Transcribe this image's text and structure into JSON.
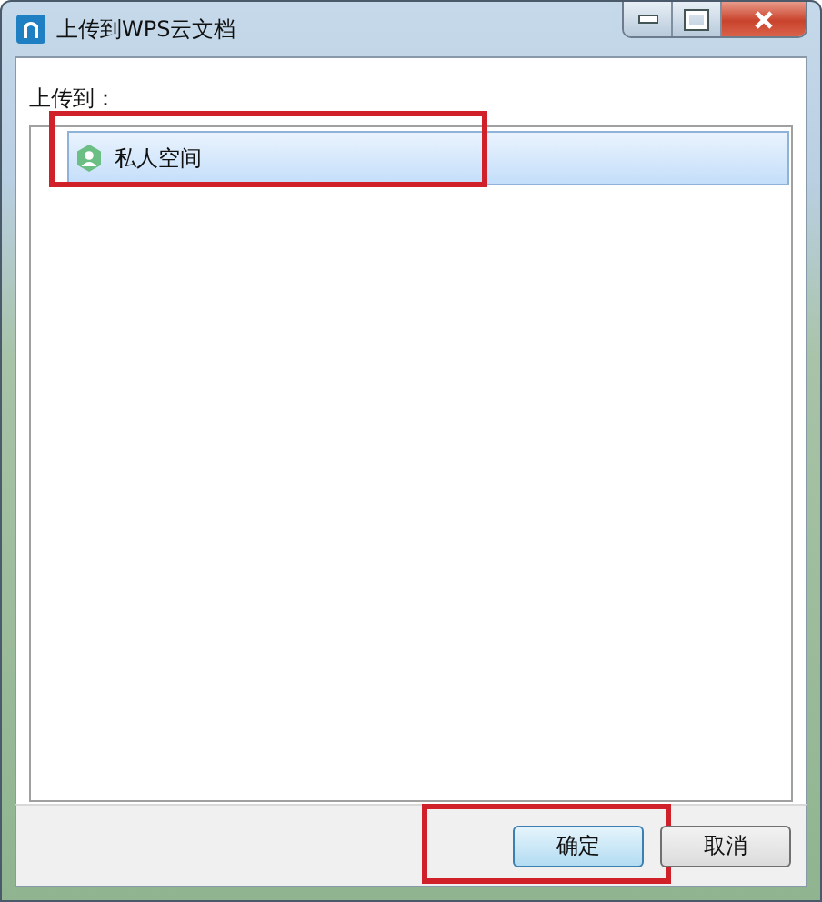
{
  "window": {
    "title": "上传到WPS云文档"
  },
  "target_label": "上传到：",
  "locations": [
    {
      "label": "私人空间",
      "selected": true,
      "highlighted": true
    }
  ],
  "buttons": [
    {
      "label": "确定",
      "default": true,
      "highlighted": true
    },
    {
      "label": "取消",
      "default": false,
      "highlighted": false
    }
  ]
}
